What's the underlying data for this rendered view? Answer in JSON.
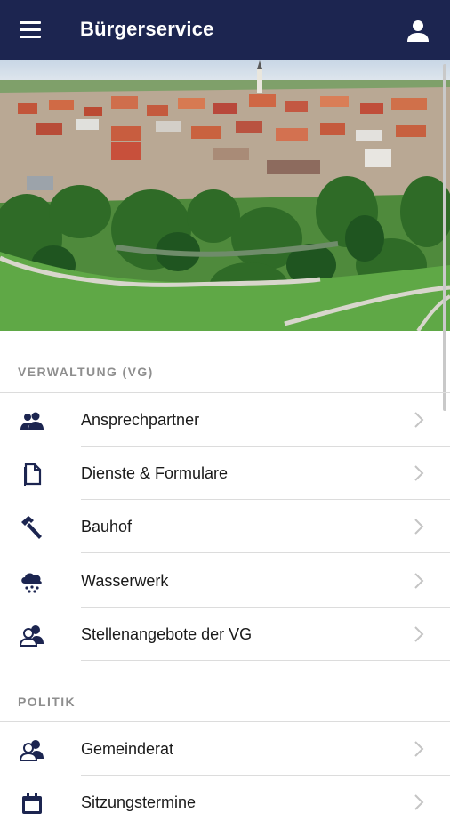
{
  "header": {
    "title": "Bürgerservice"
  },
  "icons": {
    "menu": "menu-icon",
    "user": "user-icon",
    "chevron": "chevron-right-icon"
  },
  "colors": {
    "header_bg": "#1c2550",
    "icon": "#1c2550",
    "section_header": "#8e8e8e"
  },
  "sections": [
    {
      "title": "VERWALTUNG (VG)",
      "items": [
        {
          "label": "Ansprechpartner",
          "icon": "people-icon"
        },
        {
          "label": "Dienste & Formulare",
          "icon": "document-icon"
        },
        {
          "label": "Bauhof",
          "icon": "hammer-icon"
        },
        {
          "label": "Wasserwerk",
          "icon": "water-cloud-icon"
        },
        {
          "label": "Stellenangebote der VG",
          "icon": "group-icon"
        }
      ]
    },
    {
      "title": "POLITIK",
      "items": [
        {
          "label": "Gemeinderat",
          "icon": "group-icon"
        },
        {
          "label": "Sitzungstermine",
          "icon": "calendar-icon"
        }
      ]
    }
  ]
}
